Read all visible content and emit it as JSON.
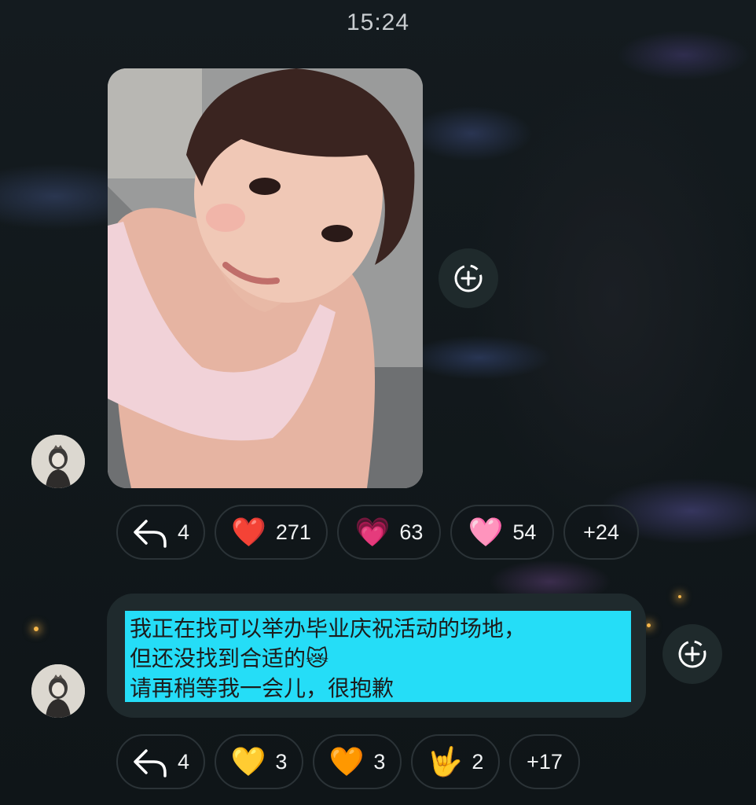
{
  "status_bar": {
    "time": "15:24"
  },
  "chat": {
    "message1": {
      "type": "photo",
      "reactions": [
        {
          "icon": "reply-icon",
          "glyph": "↶",
          "count": "4"
        },
        {
          "icon": "red-heart-icon",
          "glyph": "❤️",
          "count": "271"
        },
        {
          "icon": "sparkling-heart-icon",
          "glyph": "💗",
          "count": "63"
        },
        {
          "icon": "pink-heart-icon",
          "glyph": "🩷",
          "count": "54"
        },
        {
          "icon": "more-reactions",
          "glyph": "",
          "count": "+24"
        }
      ]
    },
    "message2": {
      "type": "text",
      "text": "我正在找可以举办毕业庆祝活动的场地，\n但还没找到合适的😿\n请再稍等我一会儿，很抱歉",
      "highlight_color": "#25ddf7",
      "reactions": [
        {
          "icon": "reply-icon",
          "glyph": "↶",
          "count": "4"
        },
        {
          "icon": "yellow-heart-icon",
          "glyph": "💛",
          "count": "3"
        },
        {
          "icon": "orange-heart-icon",
          "glyph": "🧡",
          "count": "3"
        },
        {
          "icon": "love-you-gesture-icon",
          "glyph": "🤟",
          "count": "2"
        },
        {
          "icon": "more-reactions",
          "glyph": "",
          "count": "+17"
        }
      ]
    }
  }
}
